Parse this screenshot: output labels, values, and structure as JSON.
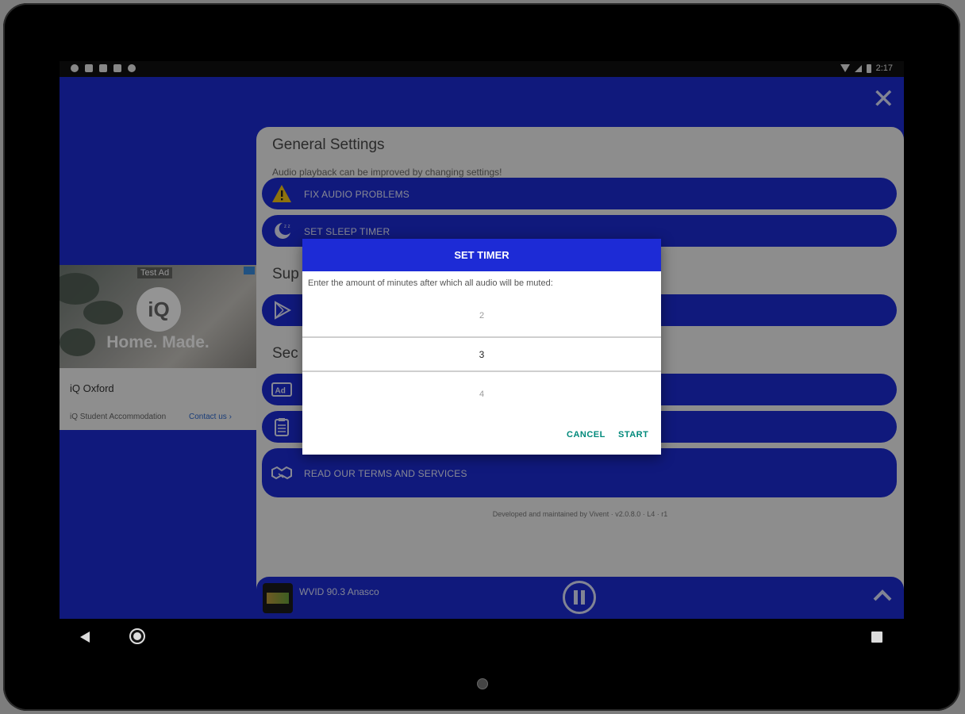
{
  "statusbar": {
    "time": "2:17"
  },
  "settings": {
    "title": "General Settings",
    "subtitle": "Audio playback can be improved by changing settings!",
    "buttons": [
      {
        "label": "FIX AUDIO PROBLEMS",
        "icon": "warning-icon"
      },
      {
        "label": "SET SLEEP TIMER",
        "icon": "moon-icon"
      },
      {
        "label": "",
        "icon": "play-store-icon"
      },
      {
        "label": "",
        "icon": "ad-icon"
      },
      {
        "label": "",
        "icon": "clipboard-icon"
      },
      {
        "label": "READ OUR TERMS AND SERVICES",
        "icon": "handshake-icon"
      }
    ],
    "section_support": "Sup",
    "section_security": "Sec",
    "footer": "Developed and maintained by Vivent · v2.0.8.0 · L4 · r1"
  },
  "ad": {
    "tag": "Test Ad",
    "logo": "iQ",
    "slogan": "Home. Made.",
    "name": "iQ Oxford",
    "description": "iQ Student Accommodation",
    "cta": "Contact us ›"
  },
  "player": {
    "station": "WVID 90.3 Anasco"
  },
  "dialog": {
    "title": "SET TIMER",
    "message": "Enter the amount of minutes after which all audio will be muted:",
    "picker": {
      "prev": "2",
      "current": "3",
      "next": "4"
    },
    "cancel_label": "CANCEL",
    "start_label": "START"
  },
  "colors": {
    "brand_blue": "#1d2bd6",
    "dialog_button": "#00897b",
    "warning_yellow": "#f5c518"
  }
}
